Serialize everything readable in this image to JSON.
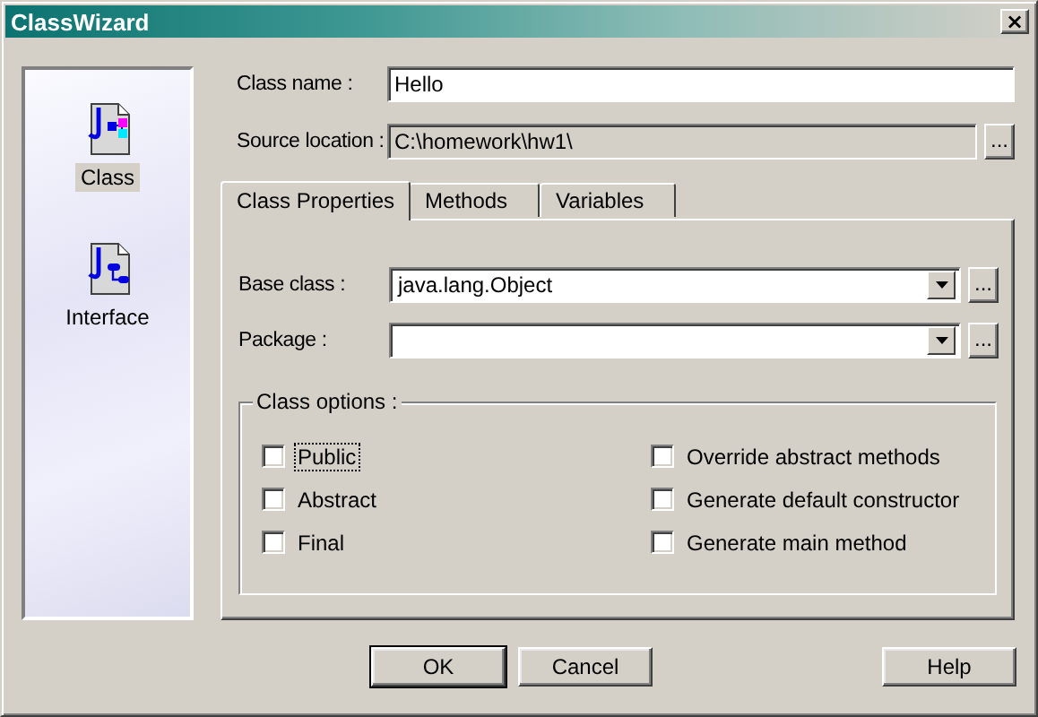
{
  "window": {
    "title": "ClassWizard",
    "close": "×"
  },
  "sidebar": {
    "items": [
      {
        "label": "Class",
        "kind": "class",
        "selected": true
      },
      {
        "label": "Interface",
        "kind": "interface",
        "selected": false
      }
    ]
  },
  "fields": [
    {
      "label": "Class name :",
      "value": "Hello",
      "kind": "text"
    },
    {
      "label": "Source location :",
      "value": "C:\\homework\\hw1\\",
      "kind": "readonly",
      "browse": "..."
    }
  ],
  "tabs": [
    {
      "label": "Class Properties",
      "selected": true
    },
    {
      "label": "Methods",
      "selected": false
    },
    {
      "label": "Variables",
      "selected": false
    }
  ],
  "tab_fields": [
    {
      "label": "Base class :",
      "value": "java.lang.Object",
      "kind": "combo",
      "browse": "..."
    },
    {
      "label": "Package :",
      "kind": "combo",
      "browse": "..."
    }
  ],
  "class_options": {
    "title": "Class options :",
    "options": [
      {
        "label": "Public",
        "checked": false,
        "focused": true
      },
      {
        "label": "Override abstract methods",
        "checked": false,
        "focused": false
      },
      {
        "label": "Abstract",
        "checked": false,
        "focused": false
      },
      {
        "label": "Generate default constructor",
        "checked": false,
        "focused": false
      },
      {
        "label": "Final",
        "checked": false,
        "focused": false
      },
      {
        "label": "Generate main method",
        "checked": false,
        "focused": false
      }
    ]
  },
  "buttons": [
    {
      "label": "OK",
      "default": true
    },
    {
      "label": "Cancel",
      "default": false
    },
    {
      "label": "Help",
      "default": false
    }
  ]
}
